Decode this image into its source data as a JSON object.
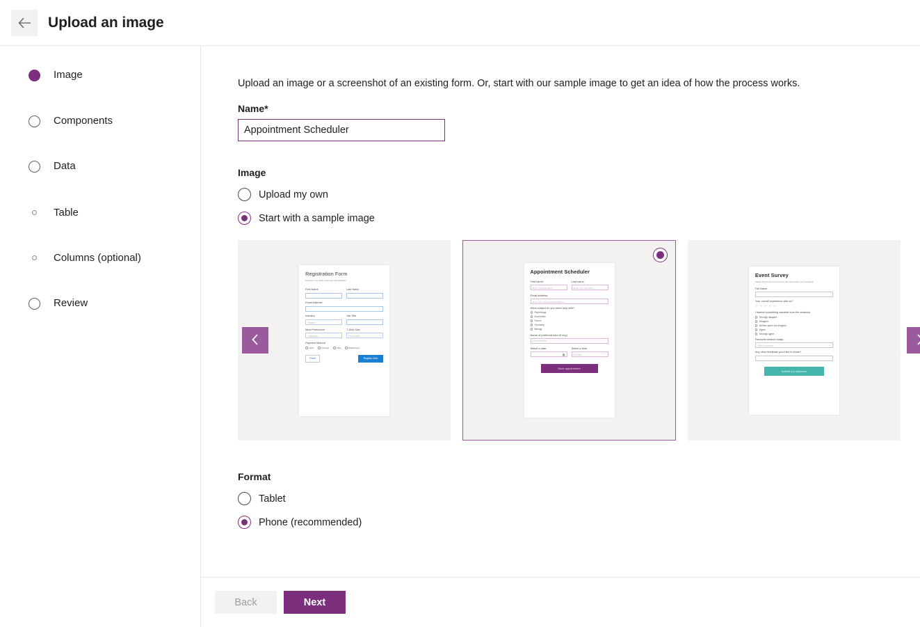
{
  "header": {
    "back_icon": "arrow-left-icon",
    "title": "Upload an image"
  },
  "sidebar": {
    "steps": [
      {
        "label": "Image",
        "state": "active",
        "type": "main"
      },
      {
        "label": "Components",
        "state": "pending",
        "type": "main"
      },
      {
        "label": "Data",
        "state": "pending",
        "type": "main"
      },
      {
        "label": "Table",
        "state": "pending",
        "type": "sub"
      },
      {
        "label": "Columns (optional)",
        "state": "pending",
        "type": "sub"
      },
      {
        "label": "Review",
        "state": "pending",
        "type": "main"
      }
    ]
  },
  "main": {
    "intro": "Upload an image or a screenshot of an existing form. Or, start with our sample image to get an idea of how the process works.",
    "name_label": "Name",
    "name_required_mark": "*",
    "name_value": "Appointment Scheduler",
    "image_section_title": "Image",
    "image_options": [
      {
        "label": "Upload my own",
        "selected": false
      },
      {
        "label": "Start with a sample image",
        "selected": true
      }
    ],
    "format_section_title": "Format",
    "format_options": [
      {
        "label": "Tablet",
        "selected": false
      },
      {
        "label": "Phone (recommended)",
        "selected": true
      }
    ],
    "gallery": {
      "prev_icon": "chevron-left-icon",
      "next_icon": "chevron-right-icon",
      "cards": [
        {
          "name": "Registration Form",
          "selected": false
        },
        {
          "name": "Appointment Scheduler",
          "selected": true
        },
        {
          "name": "Event Survey",
          "selected": false
        }
      ]
    }
  },
  "samples": {
    "registration": {
      "title": "Registration Form",
      "subtitle": "Register now while seats are still available!",
      "first_name_label": "First Name",
      "last_name_label": "Last Name",
      "email_label": "Email Address",
      "industry_label": "Industry",
      "industry_value": "Finance",
      "job_title_label": "Job Title",
      "meal_label": "Meal Preference",
      "meal_value": "Vegetarian",
      "tshirt_label": "T-Shirt Size",
      "tshirt_value": "Extra small",
      "payment_label": "Payment Method",
      "payment_options": [
        "Cash",
        "Cheque",
        "Visa",
        "Mastercard"
      ],
      "reset_btn": "Reset",
      "submit_btn": "Register Now"
    },
    "appointment": {
      "title": "Appointment Scheduler",
      "first_name_label": "First name:",
      "first_name_placeholder": "Enter your first name",
      "last_name_label": "Last name:",
      "last_name_placeholder": "Enter your last name",
      "email_label": "Email address:",
      "email_placeholder": "Enter your student email address",
      "subject_label": "What subject do you need help with?",
      "subjects": [
        "Psychology",
        "Economics",
        "French",
        "Geometry",
        "Biology"
      ],
      "tutor_label": "Name of preferred tutor (if any)",
      "tutor_value": "No preference",
      "date_label": "Select a date:",
      "time_label": "Select a time:",
      "time_value": "9:00 AM",
      "calendar_icon": "calendar-icon",
      "submit_btn": "Book appointment"
    },
    "survey": {
      "title": "Event Survey",
      "subtitle": "Please fill out the event survey. We appreciate your feedback.",
      "full_name_label": "Full Name",
      "rating_label": "Your overall experience with us?",
      "rating_stars": "☆ ☆ ☆ ☆ ☆",
      "likert_label": "I learned something valuable from the sessions",
      "likert_options": [
        "Strongly disagree",
        "Disagree",
        "Neither agree nor disagree",
        "Agree",
        "Strongly agree"
      ],
      "session_label": "Favourite session today:",
      "session_value": "Select a session",
      "feedback_label": "Any other feedback you'd like to share?",
      "submit_btn": "Submit my response"
    }
  },
  "footer": {
    "back_label": "Back",
    "next_label": "Next"
  },
  "colors": {
    "accent": "#7b2f7d",
    "accent_light": "#9b5a9d",
    "card_bg": "#f3f2f1",
    "blue": "#1a7fd4",
    "teal": "#45b6ac"
  }
}
